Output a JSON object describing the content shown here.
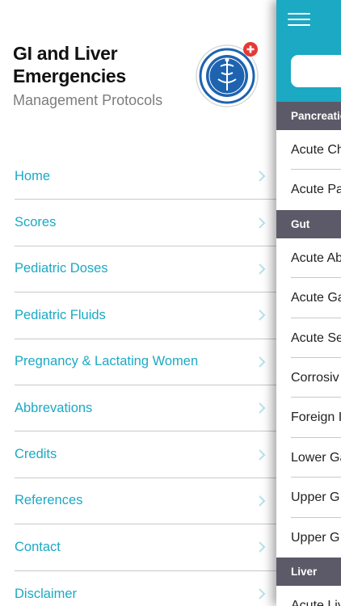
{
  "drawer": {
    "title": "GI and Liver Emergencies",
    "subtitle": "Management Protocols",
    "logo_icon": "institute-emblem",
    "badge_icon": "plus-badge-icon",
    "menu": [
      {
        "label": "Home"
      },
      {
        "label": "Scores"
      },
      {
        "label": "Pediatric Doses"
      },
      {
        "label": "Pediatric Fluids"
      },
      {
        "label": "Pregnancy & Lactating Women"
      },
      {
        "label": "Abbrevations"
      },
      {
        "label": "Credits"
      },
      {
        "label": "References"
      },
      {
        "label": "Contact"
      },
      {
        "label": "Disclaimer"
      }
    ]
  },
  "main": {
    "menu_icon": "hamburger-icon",
    "search": {
      "placeholder": ""
    },
    "sections": [
      {
        "title": "Pancreatic",
        "items": [
          "Acute Ch",
          "Acute Pa"
        ]
      },
      {
        "title": "Gut",
        "items": [
          "Acute Ab",
          "Acute Ga",
          "Acute Se",
          "Corrosiv",
          "Foreign I",
          "Lower Ga",
          "Upper G",
          "Upper G"
        ]
      },
      {
        "title": "Liver",
        "items": [
          "Acute Liv"
        ]
      }
    ]
  },
  "colors": {
    "accent": "#1ba9c4",
    "section_header": "#5c5a68",
    "divider": "#c9c9c9",
    "subtitle": "#7d7d7d",
    "badge": "#e53935"
  }
}
